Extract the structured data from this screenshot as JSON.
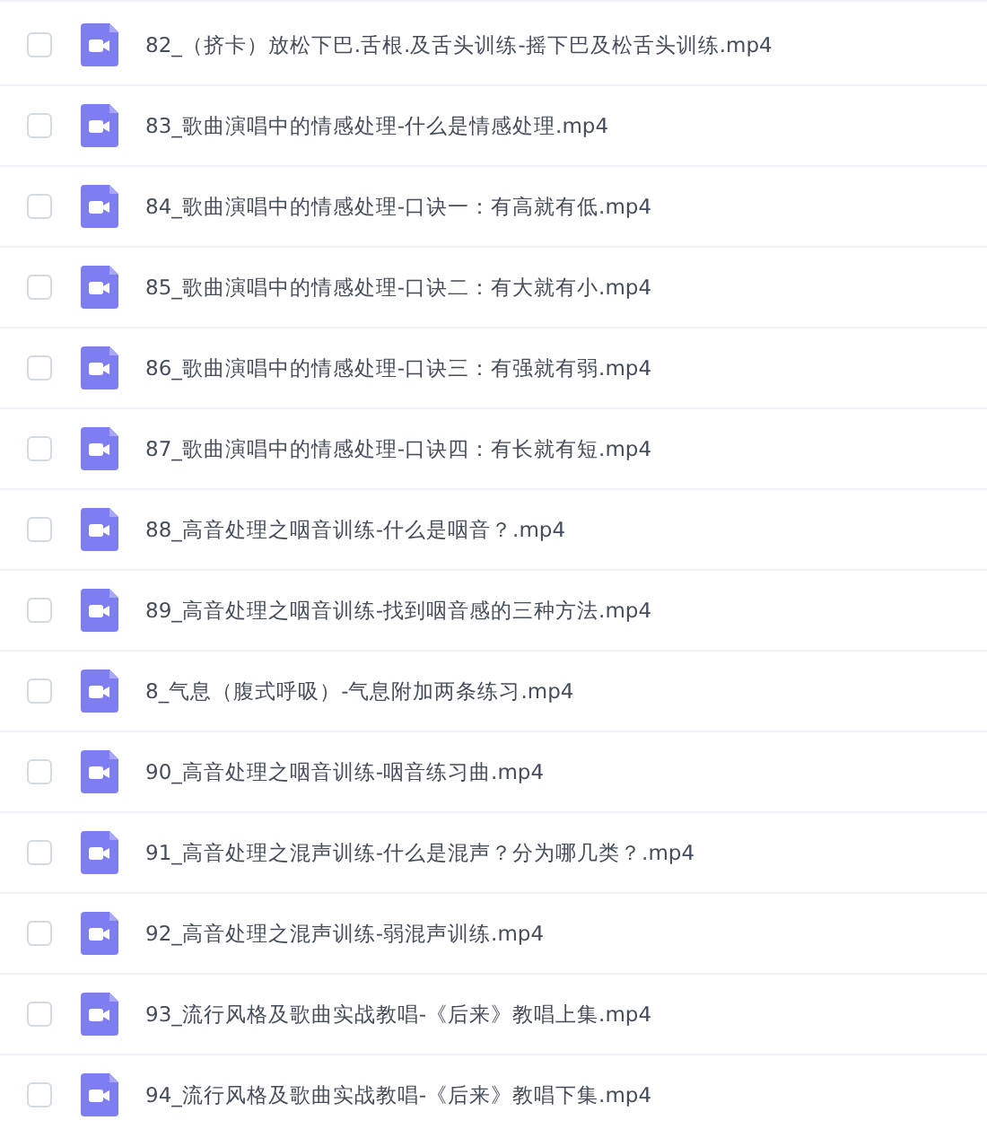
{
  "files": [
    {
      "name": "82_（挤卡）放松下巴.舌根.及舌头训练-摇下巴及松舌头训练.mp4",
      "checked": false
    },
    {
      "name": "83_歌曲演唱中的情感处理-什么是情感处理.mp4",
      "checked": false
    },
    {
      "name": "84_歌曲演唱中的情感处理-口诀一：有高就有低.mp4",
      "checked": false
    },
    {
      "name": "85_歌曲演唱中的情感处理-口诀二：有大就有小.mp4",
      "checked": false
    },
    {
      "name": "86_歌曲演唱中的情感处理-口诀三：有强就有弱.mp4",
      "checked": false
    },
    {
      "name": "87_歌曲演唱中的情感处理-口诀四：有长就有短.mp4",
      "checked": false
    },
    {
      "name": "88_高音处理之咽音训练-什么是咽音？.mp4",
      "checked": false
    },
    {
      "name": "89_高音处理之咽音训练-找到咽音感的三种方法.mp4",
      "checked": false
    },
    {
      "name": "8_气息（腹式呼吸）-气息附加两条练习.mp4",
      "checked": false
    },
    {
      "name": "90_高音处理之咽音训练-咽音练习曲.mp4",
      "checked": false
    },
    {
      "name": "91_高音处理之混声训练-什么是混声？分为哪几类？.mp4",
      "checked": false
    },
    {
      "name": "92_高音处理之混声训练-弱混声训练.mp4",
      "checked": false
    },
    {
      "name": "93_流行风格及歌曲实战教唱-《后来》教唱上集.mp4",
      "checked": false
    },
    {
      "name": "94_流行风格及歌曲实战教唱-《后来》教唱下集.mp4",
      "checked": false
    }
  ]
}
